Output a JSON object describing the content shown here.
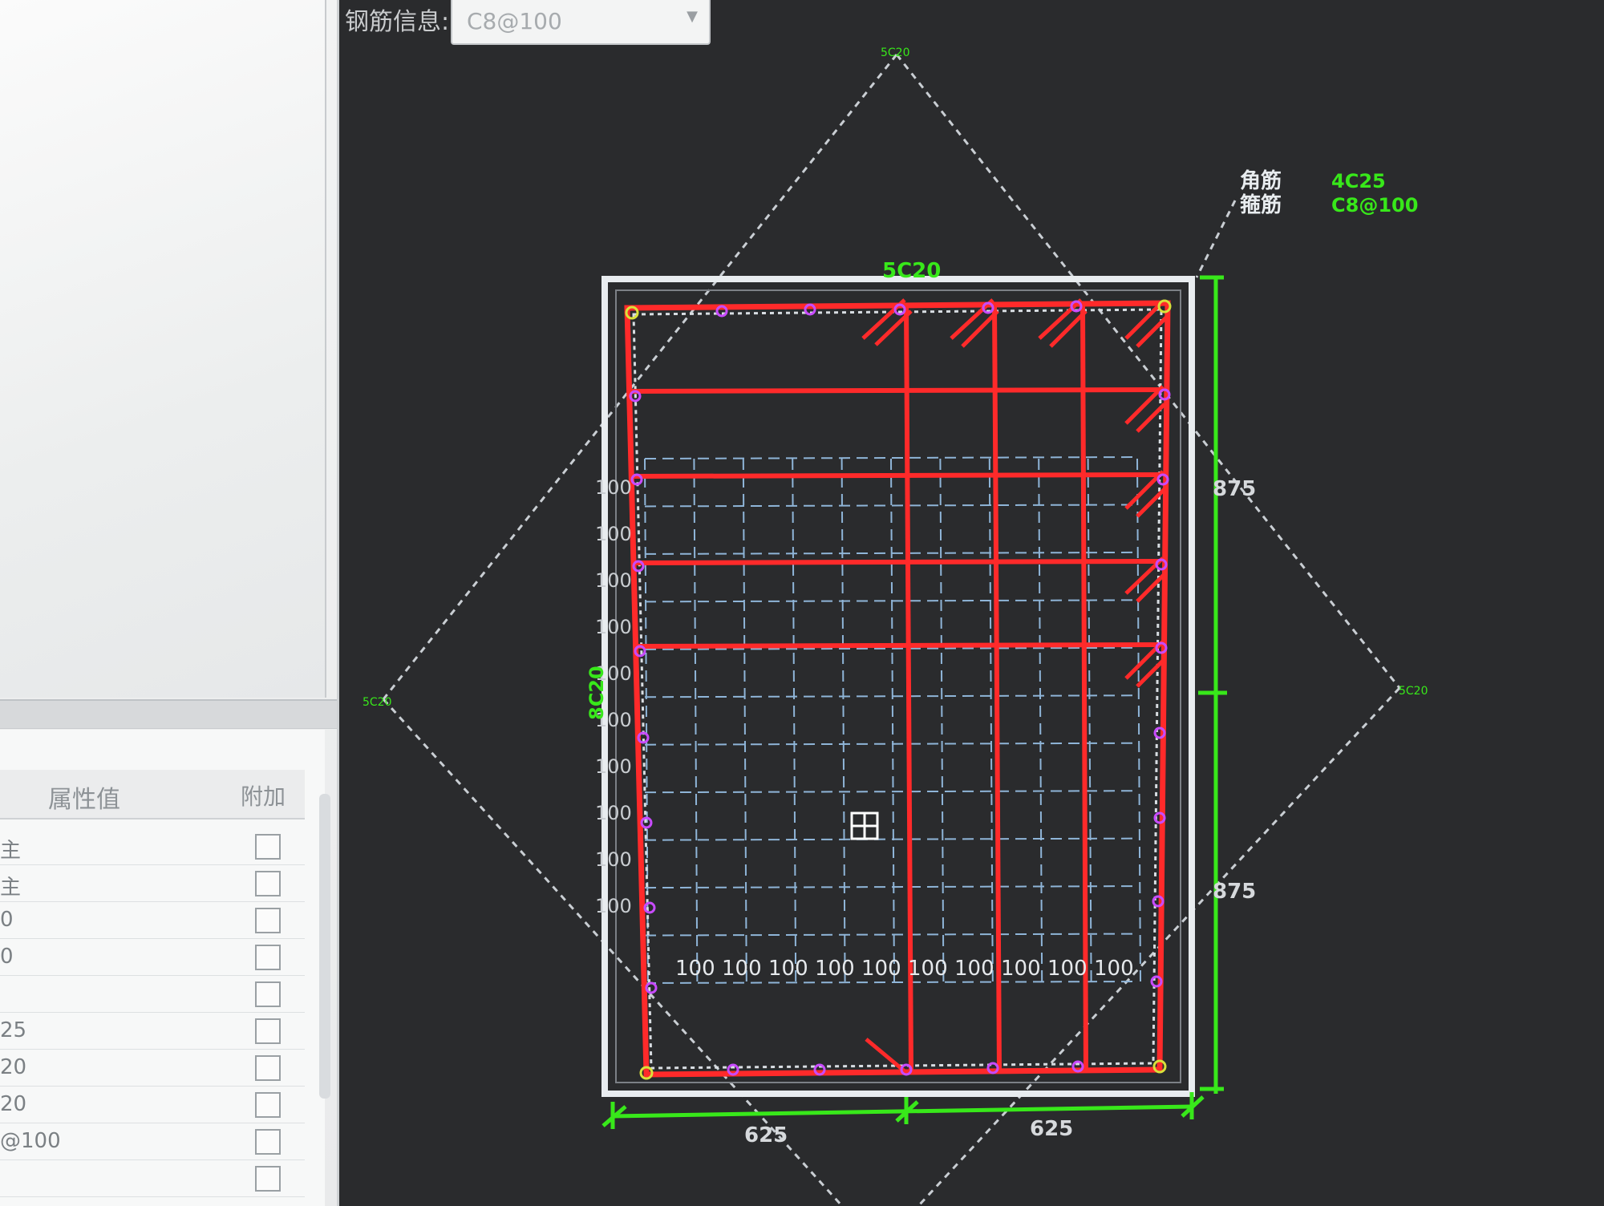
{
  "toolbar": {
    "rebar_info_label": "钢筋信息:",
    "rebar_info_value": "C8@100"
  },
  "property_grid": {
    "header_value": "属性值",
    "header_append": "附加",
    "rows": [
      {
        "value": "主"
      },
      {
        "value": "主"
      },
      {
        "value": "0"
      },
      {
        "value": "0"
      },
      {
        "value": ""
      },
      {
        "value": "25"
      },
      {
        "value": "20"
      },
      {
        "value": "20"
      },
      {
        "value": "@100"
      },
      {
        "value": ""
      }
    ]
  },
  "drawing": {
    "legend": {
      "corner_bar_label": "角筋",
      "corner_bar_value": "4C25",
      "stirrup_label": "箍筋",
      "stirrup_value": "C8@100"
    },
    "top_side_bars": "5C20",
    "left_side_bars": "8C20",
    "diamond_labels": {
      "top": "5C20",
      "left": "5C20",
      "right": "5C20"
    },
    "dim_right_upper": "875",
    "dim_right_lower": "875",
    "dim_bottom_left": "625",
    "dim_bottom_right": "625",
    "grid_spacing_label": "100",
    "grid_bottom_labels": [
      "100",
      "100",
      "100",
      "100",
      "100",
      "100",
      "100",
      "100",
      "100",
      "100"
    ],
    "grid_left_labels": [
      "100",
      "100",
      "100",
      "100",
      "100",
      "100",
      "100",
      "100",
      "100",
      "100"
    ]
  },
  "colors": {
    "canvas_bg": "#2a2b2d",
    "rebar_red": "#ff2a2a",
    "dimension_green": "#38e81a",
    "node_magenta": "#c84bff",
    "grid_blue": "#8fb5d8",
    "outline_white": "#e8ecef"
  }
}
